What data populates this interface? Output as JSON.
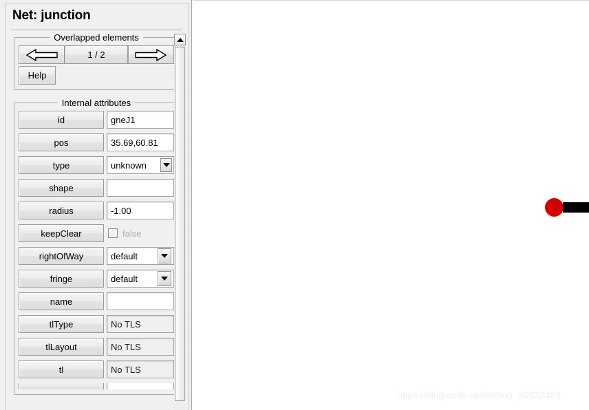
{
  "panel": {
    "title": "Net: junction",
    "overlapped": {
      "group_title": "Overlapped elements",
      "prev_icon": "arrow-left-icon",
      "next_icon": "arrow-right-icon",
      "counter": "1 / 2",
      "help_label": "Help"
    },
    "internal": {
      "group_title": "Internal attributes",
      "rows": [
        {
          "label": "id",
          "value": "gneJ1",
          "kind": "text"
        },
        {
          "label": "pos",
          "value": "35.69,60.81",
          "kind": "text"
        },
        {
          "label": "type",
          "value": "unknown",
          "kind": "combo-flat"
        },
        {
          "label": "shape",
          "value": "",
          "kind": "text"
        },
        {
          "label": "radius",
          "value": "-1.00",
          "kind": "text"
        },
        {
          "label": "keepClear",
          "value": "false",
          "kind": "checkbox",
          "checked": false
        },
        {
          "label": "rightOfWay",
          "value": "default",
          "kind": "combo-box"
        },
        {
          "label": "fringe",
          "value": "default",
          "kind": "combo-box"
        },
        {
          "label": "name",
          "value": "",
          "kind": "text"
        },
        {
          "label": "tlType",
          "value": "No TLS",
          "kind": "text-disabled"
        },
        {
          "label": "tlLayout",
          "value": "No TLS",
          "kind": "text-disabled"
        },
        {
          "label": "tl",
          "value": "No TLS",
          "kind": "text-disabled"
        }
      ]
    },
    "scrollbar": {
      "up_icon": "scroll-up-arrow-icon",
      "thumb_name": "scroll-thumb"
    }
  },
  "canvas": {
    "junction_color": "#d40000",
    "edge_color": "#000000",
    "watermark": "https://blog.csdn.net/weixin_50632459"
  }
}
